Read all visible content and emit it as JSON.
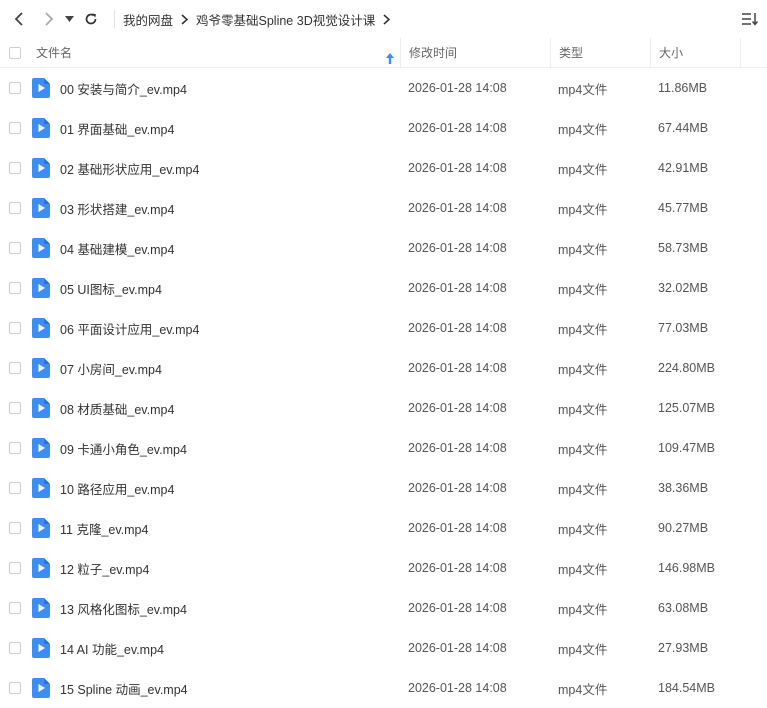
{
  "toolbar": {
    "breadcrumb": [
      "我的网盘",
      "鸡爷零基础Spline 3D视觉设计课"
    ]
  },
  "columns": {
    "name": "文件名",
    "modified": "修改时间",
    "type": "类型",
    "size": "大小"
  },
  "colors": {
    "icon_blue": "#3b8ff0",
    "icon_blue_dark": "#2a73d6"
  },
  "files": [
    {
      "name": "00 安装与简介_ev.mp4",
      "modified": "2026-01-28 14:08",
      "type": "mp4文件",
      "size": "11.86MB"
    },
    {
      "name": "01 界面基础_ev.mp4",
      "modified": "2026-01-28 14:08",
      "type": "mp4文件",
      "size": "67.44MB"
    },
    {
      "name": "02 基础形状应用_ev.mp4",
      "modified": "2026-01-28 14:08",
      "type": "mp4文件",
      "size": "42.91MB"
    },
    {
      "name": "03 形状搭建_ev.mp4",
      "modified": "2026-01-28 14:08",
      "type": "mp4文件",
      "size": "45.77MB"
    },
    {
      "name": "04 基础建模_ev.mp4",
      "modified": "2026-01-28 14:08",
      "type": "mp4文件",
      "size": "58.73MB"
    },
    {
      "name": "05 UI图标_ev.mp4",
      "modified": "2026-01-28 14:08",
      "type": "mp4文件",
      "size": "32.02MB"
    },
    {
      "name": "06 平面设计应用_ev.mp4",
      "modified": "2026-01-28 14:08",
      "type": "mp4文件",
      "size": "77.03MB"
    },
    {
      "name": "07 小房间_ev.mp4",
      "modified": "2026-01-28 14:08",
      "type": "mp4文件",
      "size": "224.80MB"
    },
    {
      "name": "08 材质基础_ev.mp4",
      "modified": "2026-01-28 14:08",
      "type": "mp4文件",
      "size": "125.07MB"
    },
    {
      "name": "09 卡通小角色_ev.mp4",
      "modified": "2026-01-28 14:08",
      "type": "mp4文件",
      "size": "109.47MB"
    },
    {
      "name": "10 路径应用_ev.mp4",
      "modified": "2026-01-28 14:08",
      "type": "mp4文件",
      "size": "38.36MB"
    },
    {
      "name": "11 克隆_ev.mp4",
      "modified": "2026-01-28 14:08",
      "type": "mp4文件",
      "size": "90.27MB"
    },
    {
      "name": "12 粒子_ev.mp4",
      "modified": "2026-01-28 14:08",
      "type": "mp4文件",
      "size": "146.98MB"
    },
    {
      "name": "13 风格化图标_ev.mp4",
      "modified": "2026-01-28 14:08",
      "type": "mp4文件",
      "size": "63.08MB"
    },
    {
      "name": "14 AI 功能_ev.mp4",
      "modified": "2026-01-28 14:08",
      "type": "mp4文件",
      "size": "27.93MB"
    },
    {
      "name": "15 Spline 动画_ev.mp4",
      "modified": "2026-01-28 14:08",
      "type": "mp4文件",
      "size": "184.54MB"
    }
  ]
}
